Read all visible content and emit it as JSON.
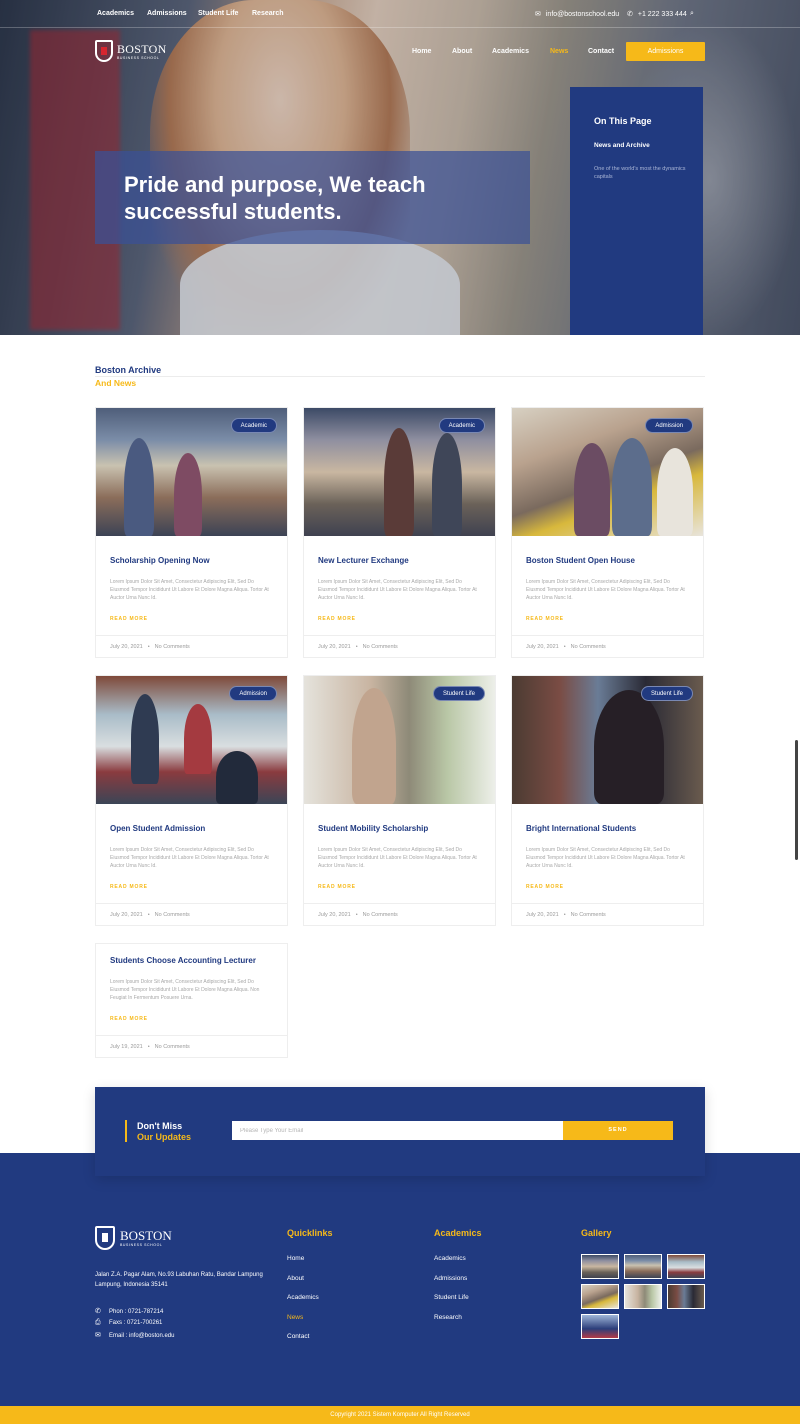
{
  "topbar": {
    "links": [
      "Academics",
      "Admissions",
      "Student Life",
      "Research"
    ],
    "email": "info@bostonschool.edu",
    "phone": "+1 222 333 444"
  },
  "brand": {
    "name": "BOSTON",
    "tagline": "BUSINESS SCHOOL"
  },
  "nav": {
    "items": [
      "Home",
      "About",
      "Academics",
      "News",
      "Contact"
    ],
    "active": "News",
    "cta": "Admissions"
  },
  "hero": {
    "title": "Pride and purpose, We teach successful students.",
    "on_this_page": "On This Page",
    "page_item": "News and Archive",
    "page_desc": "One of the world's most the dynamics capitals"
  },
  "archive": {
    "title": "Boston Archive",
    "subtitle": "And News"
  },
  "posts": [
    {
      "category": "Academic",
      "title": "Scholarship Opening Now",
      "excerpt": "Lorem Ipsum Dolor Sit Amet, Consectetur Adipiscing Elit, Sed Do Eiusmod Tempor Incididunt Ut Labore Et Dolore Magna Aliqua. Tortor At Auctor Urna Nunc Id.",
      "more": "READ MORE",
      "date": "July 20, 2021",
      "comments": "No Comments"
    },
    {
      "category": "Academic",
      "title": "New Lecturer Exchange",
      "excerpt": "Lorem Ipsum Dolor Sit Amet, Consectetur Adipiscing Elit, Sed Do Eiusmod Tempor Incididunt Ut Labore Et Dolore Magna Aliqua. Tortor At Auctor Urna Nunc Id.",
      "more": "READ MORE",
      "date": "July 20, 2021",
      "comments": "No Comments"
    },
    {
      "category": "Admission",
      "title": "Boston Student Open House",
      "excerpt": "Lorem Ipsum Dolor Sit Amet, Consectetur Adipiscing Elit, Sed Do Eiusmod Tempor Incididunt Ut Labore Et Dolore Magna Aliqua. Tortor At Auctor Urna Nunc Id.",
      "more": "READ MORE",
      "date": "July 20, 2021",
      "comments": "No Comments"
    },
    {
      "category": "Admission",
      "title": "Open Student Admission",
      "excerpt": "Lorem Ipsum Dolor Sit Amet, Consectetur Adipiscing Elit, Sed Do Eiusmod Tempor Incididunt Ut Labore Et Dolore Magna Aliqua. Tortor At Auctor Urna Nunc Id.",
      "more": "READ MORE",
      "date": "July 20, 2021",
      "comments": "No Comments"
    },
    {
      "category": "Student Life",
      "title": "Student Mobility Scholarship",
      "excerpt": "Lorem Ipsum Dolor Sit Amet, Consectetur Adipiscing Elit, Sed Do Eiusmod Tempor Incididunt Ut Labore Et Dolore Magna Aliqua. Tortor At Auctor Urna Nunc Id.",
      "more": "READ MORE",
      "date": "July 20, 2021",
      "comments": "No Comments"
    },
    {
      "category": "Student Life",
      "title": "Bright International Students",
      "excerpt": "Lorem Ipsum Dolor Sit Amet, Consectetur Adipiscing Elit, Sed Do Eiusmod Tempor Incididunt Ut Labore Et Dolore Magna Aliqua. Tortor At Auctor Urna Nunc Id.",
      "more": "READ MORE",
      "date": "July 20, 2021",
      "comments": "No Comments"
    },
    {
      "category": "",
      "title": "Students Choose Accounting Lecturer",
      "excerpt": "Lorem Ipsum Dolor Sit Amet, Consectetur Adipiscing Elit, Sed Do Eiusmod Tempor Incididunt Ut Labore Et Dolore Magna Aliqua. Non Feugiat In Fermentum Posuere Urna.",
      "more": "READ MORE",
      "date": "July 19, 2021",
      "comments": "No Comments"
    }
  ],
  "subscribe": {
    "line1": "Don't Miss",
    "line2": "Our Updates",
    "placeholder": "Please Type Your Email",
    "button": "SEND"
  },
  "footer": {
    "address": "Jalan Z.A. Pagar Alam, No.93 Labuhan Ratu, Bandar Lampung Lampung, Indonesia 35141",
    "phone": "Phon : 0721-787214",
    "fax": "Faxs : 0721-700261",
    "email": "Email : info@boston.edu",
    "quicklinks_title": "Quicklinks",
    "quicklinks": [
      "Home",
      "About",
      "Academics",
      "News",
      "Contact"
    ],
    "academics_title": "Academics",
    "academics": [
      "Academics",
      "Admissions",
      "Student Life",
      "Research"
    ],
    "gallery_title": "Gallery",
    "copyright": "Copyright 2021 Sistem Komputer All Right Reserved"
  },
  "colors": {
    "primary": "#213a80",
    "accent": "#f6b919"
  }
}
